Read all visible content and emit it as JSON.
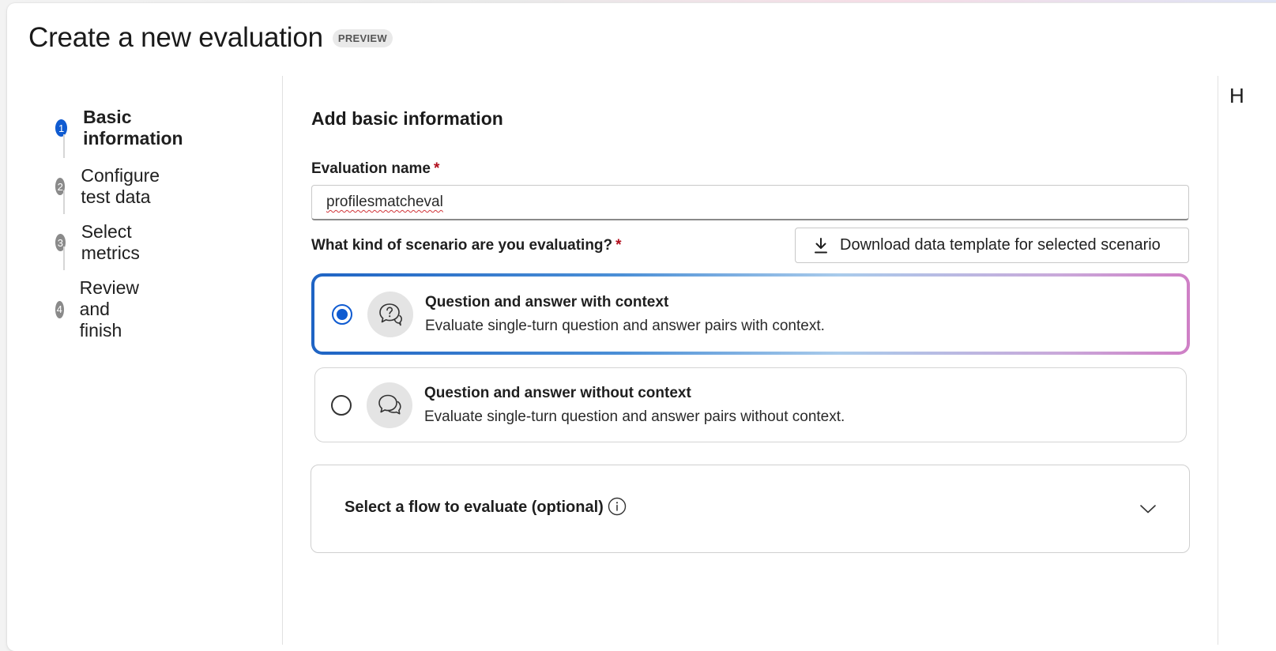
{
  "page": {
    "title": "Create a new evaluation",
    "badge": "PREVIEW",
    "right_peek_text": "H"
  },
  "steps": [
    {
      "number": "1",
      "label": "Basic information",
      "active": true
    },
    {
      "number": "2",
      "label": "Configure test data",
      "active": false
    },
    {
      "number": "3",
      "label": "Select metrics",
      "active": false
    },
    {
      "number": "4",
      "label": "Review and finish",
      "active": false
    }
  ],
  "form": {
    "section_title": "Add basic information",
    "name_label": "Evaluation name",
    "name_value": "profilesmatcheval",
    "required_marker": "*",
    "scenario_label": "What kind of scenario are you evaluating?",
    "download_label": "Download data template for selected scenario",
    "scenarios": [
      {
        "title": "Question and answer with context",
        "description": "Evaluate single-turn question and answer pairs with context.",
        "selected": true,
        "icon": "chat-question-icon"
      },
      {
        "title": "Question and answer without context",
        "description": "Evaluate single-turn question and answer pairs without context.",
        "selected": false,
        "icon": "chat-bubbles-icon"
      }
    ],
    "flow_label": "Select a flow to evaluate (optional)"
  },
  "colors": {
    "accent": "#0f5bd1",
    "required": "#b10e1c"
  }
}
